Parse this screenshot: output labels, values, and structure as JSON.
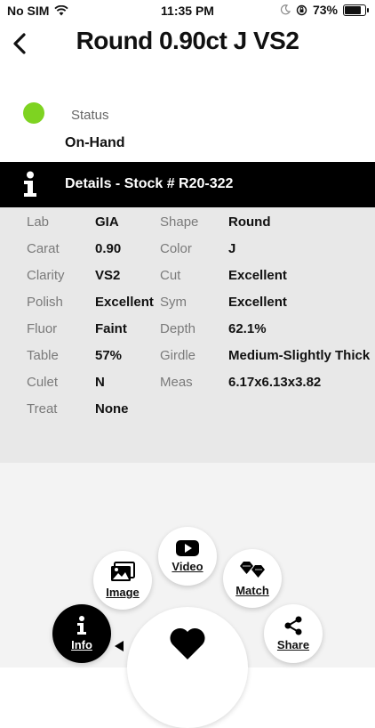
{
  "statusbar": {
    "carrier": "No SIM",
    "time": "11:35 PM",
    "battery": "73%"
  },
  "nav": {
    "title": "Round 0.90ct J VS2"
  },
  "stock_status": {
    "label": "Status",
    "value": "On-Hand",
    "color": "#7ed321"
  },
  "details": {
    "header": "Details - Stock # R20-322",
    "rows": [
      {
        "l1": "Lab",
        "v1": "GIA",
        "l2": "Shape",
        "v2": "Round"
      },
      {
        "l1": "Carat",
        "v1": "0.90",
        "l2": "Color",
        "v2": "J"
      },
      {
        "l1": "Clarity",
        "v1": "VS2",
        "l2": "Cut",
        "v2": "Excellent"
      },
      {
        "l1": "Polish",
        "v1": "Excellent",
        "l2": "Sym",
        "v2": "Excellent"
      },
      {
        "l1": "Fluor",
        "v1": "Faint",
        "l2": "Depth",
        "v2": "62.1%"
      },
      {
        "l1": "Table",
        "v1": "57%",
        "l2": "Girdle",
        "v2": "Medium-Slightly Thick"
      },
      {
        "l1": "Culet",
        "v1": "N",
        "l2": "Meas",
        "v2": "6.17x6.13x3.82"
      },
      {
        "l1": "Treat",
        "v1": "None",
        "l2": "",
        "v2": ""
      }
    ]
  },
  "menu": {
    "image": "Image",
    "video": "Video",
    "match": "Match",
    "info": "Info",
    "share": "Share"
  }
}
